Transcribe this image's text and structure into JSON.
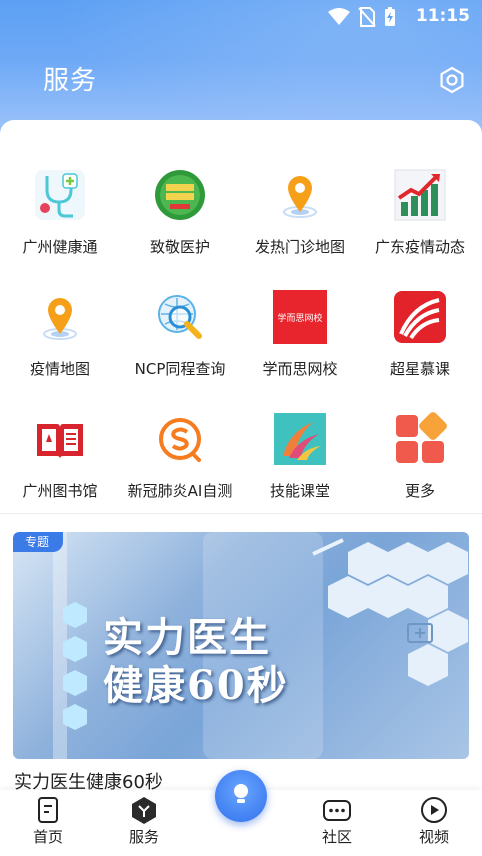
{
  "status_bar": {
    "time": "11:15"
  },
  "header": {
    "title": "服务"
  },
  "services": [
    {
      "label": "广州健康通",
      "icon": "health-stethoscope-icon"
    },
    {
      "label": "致敬医护",
      "icon": "salute-medics-badge-icon"
    },
    {
      "label": "发热门诊地图",
      "icon": "map-pin-icon"
    },
    {
      "label": "广东疫情动态",
      "icon": "trend-chart-icon"
    },
    {
      "label": "疫情地图",
      "icon": "map-pin-icon"
    },
    {
      "label": "NCP同程查询",
      "icon": "magnifier-globe-icon"
    },
    {
      "label": "学而思网校",
      "icon": "xueersi-logo-icon",
      "logo_text": "学而思网校"
    },
    {
      "label": "超星慕课",
      "icon": "chaoxing-logo-icon"
    },
    {
      "label": "广州图书馆",
      "icon": "book-icon"
    },
    {
      "label": "新冠肺炎AI自测",
      "icon": "ai-s-logo-icon"
    },
    {
      "label": "技能课堂",
      "icon": "skills-class-logo-icon"
    },
    {
      "label": "更多",
      "icon": "more-tiles-icon"
    }
  ],
  "banner": {
    "tag": "专题",
    "line1": "实力医生",
    "line2": "健康60秒"
  },
  "article": {
    "title": "实力医生健康60秒"
  },
  "tabbar": {
    "home": "首页",
    "services": "服务",
    "community": "社区",
    "video": "视频"
  },
  "colors": {
    "accent": "#3b7be8",
    "header": "#5da0f4"
  }
}
